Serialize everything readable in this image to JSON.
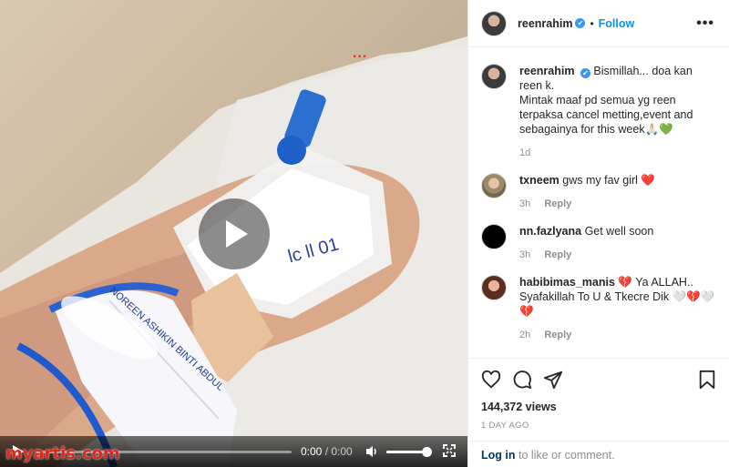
{
  "video": {
    "overlay_dots": "...",
    "watermark": "myartis.com",
    "time_current": "0:00",
    "time_separator": " / ",
    "time_duration": "0:00",
    "progress": 0,
    "volume": 0.85
  },
  "header": {
    "username": "reenrahim",
    "verified_mark": "✔",
    "separator": "•",
    "follow_label": "Follow",
    "more_label": "•••"
  },
  "caption": {
    "username": "reenrahim",
    "text": "Bismillah... doa kan reen k.\nMintak maaf pd semua yg reen terpaksa cancel metting,event and sebagainya for this week🙏🏻💚",
    "age": "1d"
  },
  "comments": [
    {
      "username": "txneem",
      "text": "gws my fav girl ❤️",
      "age": "3h",
      "reply_label": "Reply"
    },
    {
      "username": "nn.fazlyana",
      "text": "Get well soon",
      "age": "3h",
      "reply_label": "Reply"
    },
    {
      "username": "habibimas_manis",
      "text": "💔 Ya ALLAH.. Syafakillah To U & Tkecre Dik 🤍💔🤍💔",
      "age": "2h",
      "reply_label": "Reply"
    }
  ],
  "stats": {
    "views": "144,372 views",
    "date": "1 DAY AGO"
  },
  "login": {
    "link_label": "Log in",
    "rest": " to like or comment."
  },
  "icons": [
    "heart-icon",
    "comment-icon",
    "share-icon",
    "bookmark-icon",
    "play-icon",
    "volume-icon",
    "fullscreen-icon",
    "verified-icon"
  ],
  "colors": {
    "accent": "#0095f6",
    "verified": "#3897f0",
    "watermark": "#e1261c"
  }
}
